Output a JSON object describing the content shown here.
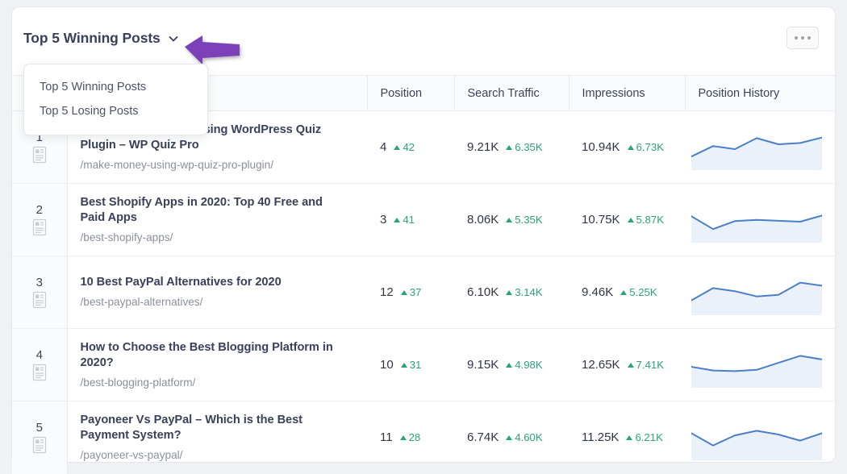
{
  "widget": {
    "title": "Top 5 Winning Posts",
    "chevron_icon": "chevron-down-icon",
    "kebab_icon": "more-options-icon"
  },
  "dropdown": {
    "open": true,
    "options": [
      {
        "label": "Top 5 Winning Posts"
      },
      {
        "label": "Top 5 Losing Posts"
      }
    ]
  },
  "annotation": {
    "type": "arrow",
    "direction": "left",
    "color": "#7b3fb8"
  },
  "table": {
    "columns": [
      {
        "key": "rank",
        "label": ""
      },
      {
        "key": "post",
        "label": ""
      },
      {
        "key": "position",
        "label": "Position"
      },
      {
        "key": "search_traffic",
        "label": "Search Traffic"
      },
      {
        "key": "impressions",
        "label": "Impressions"
      },
      {
        "key": "position_history",
        "label": "Position History"
      }
    ],
    "rows": [
      {
        "rank": "1",
        "icon": "article-icon",
        "title": "How to Make Money Using WordPress Quiz Plugin – WP Quiz Pro",
        "url": "/make-money-using-wp-quiz-pro-plugin/",
        "position": "4",
        "position_delta": "42",
        "search_traffic": "9.21K",
        "search_traffic_delta": "6.35K",
        "impressions": "10.94K",
        "impressions_delta": "6.73K"
      },
      {
        "rank": "2",
        "icon": "article-icon",
        "title": "Best Shopify Apps in 2020: Top 40 Free and Paid Apps",
        "url": "/best-shopify-apps/",
        "position": "3",
        "position_delta": "41",
        "search_traffic": "8.06K",
        "search_traffic_delta": "5.35K",
        "impressions": "10.75K",
        "impressions_delta": "5.87K"
      },
      {
        "rank": "3",
        "icon": "article-icon",
        "title": "10 Best PayPal Alternatives for 2020",
        "url": "/best-paypal-alternatives/",
        "position": "12",
        "position_delta": "37",
        "search_traffic": "6.10K",
        "search_traffic_delta": "3.14K",
        "impressions": "9.46K",
        "impressions_delta": "5.25K"
      },
      {
        "rank": "4",
        "icon": "article-icon",
        "title": "How to Choose the Best Blogging Platform in 2020?",
        "url": "/best-blogging-platform/",
        "position": "10",
        "position_delta": "31",
        "search_traffic": "9.15K",
        "search_traffic_delta": "4.98K",
        "impressions": "12.65K",
        "impressions_delta": "7.41K"
      },
      {
        "rank": "5",
        "icon": "article-icon",
        "title": "Payoneer Vs PayPal – Which is the Best Payment System?",
        "url": "/payoneer-vs-paypal/",
        "position": "11",
        "position_delta": "28",
        "search_traffic": "6.74K",
        "search_traffic_delta": "4.60K",
        "impressions": "11.25K",
        "impressions_delta": "6.21K"
      }
    ]
  },
  "chart_data": {
    "type": "area",
    "title": "Position History",
    "line_color": "#4a7fc9",
    "fill_color": "#eaf1fa",
    "ylim": [
      0,
      1
    ],
    "grid": false,
    "series": [
      {
        "name": "row-1",
        "x": [
          0,
          1,
          2,
          3,
          4,
          5,
          6
        ],
        "values": [
          0.18,
          0.52,
          0.42,
          0.78,
          0.58,
          0.62,
          0.8
        ]
      },
      {
        "name": "row-2",
        "x": [
          0,
          1,
          2,
          3,
          4,
          5,
          6
        ],
        "values": [
          0.6,
          0.18,
          0.44,
          0.48,
          0.45,
          0.42,
          0.62
        ]
      },
      {
        "name": "row-3",
        "x": [
          0,
          1,
          2,
          3,
          4,
          5,
          6
        ],
        "values": [
          0.22,
          0.62,
          0.52,
          0.35,
          0.4,
          0.8,
          0.7
        ]
      },
      {
        "name": "row-4",
        "x": [
          0,
          1,
          2,
          3,
          4,
          5,
          6
        ],
        "values": [
          0.42,
          0.3,
          0.28,
          0.32,
          0.55,
          0.78,
          0.66
        ]
      },
      {
        "name": "row-5",
        "x": [
          0,
          1,
          2,
          3,
          4,
          5,
          6
        ],
        "values": [
          0.62,
          0.22,
          0.55,
          0.7,
          0.58,
          0.38,
          0.62
        ]
      }
    ]
  }
}
